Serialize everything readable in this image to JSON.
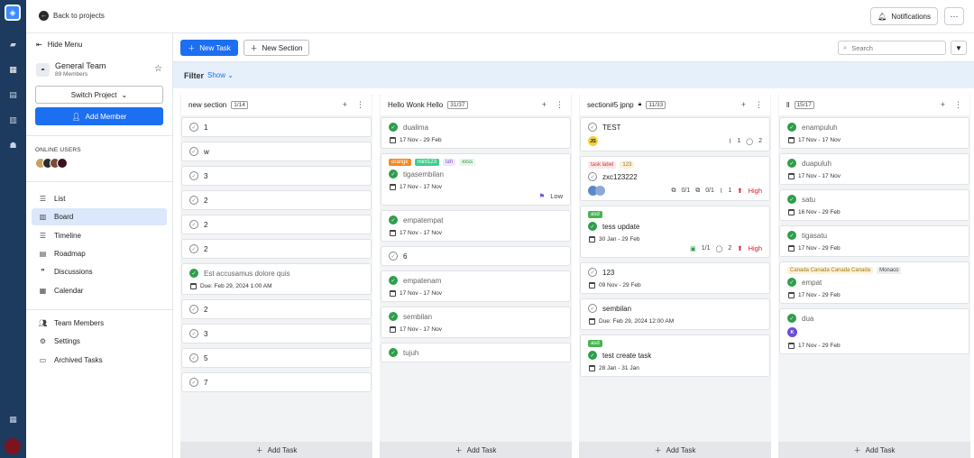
{
  "topbar": {
    "back_label": "Back to projects",
    "notifications_label": "Notifications"
  },
  "sidebar": {
    "hide_menu": "Hide Menu",
    "team_name": "General Team",
    "team_members": "89 Members",
    "switch_project": "Switch Project",
    "add_member": "Add Member",
    "online_users": "ONLINE USERS",
    "online_avatar_colors": [
      "#c8a060",
      "#2b2b2b",
      "#7a4a3a",
      "#3a1020"
    ],
    "views": [
      {
        "label": "List",
        "icon": "list-icon"
      },
      {
        "label": "Board",
        "icon": "board-icon",
        "active": true
      },
      {
        "label": "Timeline",
        "icon": "timeline-icon"
      },
      {
        "label": "Roadmap",
        "icon": "roadmap-icon"
      },
      {
        "label": "Discussions",
        "icon": "discussions-icon"
      },
      {
        "label": "Calendar",
        "icon": "calendar-icon"
      }
    ],
    "settings": [
      {
        "label": "Team Members",
        "icon": "team-members-icon"
      },
      {
        "label": "Settings",
        "icon": "gear-icon"
      },
      {
        "label": "Archived Tasks",
        "icon": "archive-icon"
      }
    ]
  },
  "toolbar": {
    "new_task": "New Task",
    "new_section": "New Section",
    "search_placeholder": "Search"
  },
  "filter": {
    "label": "Filter",
    "show": "Show"
  },
  "add_task_label": "Add Task",
  "columns": [
    {
      "title": "new section",
      "count": "1/14",
      "locked": false,
      "cards": [
        {
          "title": "1"
        },
        {
          "title": "w"
        },
        {
          "title": "3"
        },
        {
          "title": "2"
        },
        {
          "title": "2"
        },
        {
          "title": "2"
        },
        {
          "title": "Est accusamus dolore quis",
          "done": true,
          "muted": true,
          "due": "Due: Feb 29, 2024 1:00 AM"
        },
        {
          "title": "2"
        },
        {
          "title": "3"
        },
        {
          "title": "5"
        },
        {
          "title": "7"
        }
      ]
    },
    {
      "title": "Hello Wonk Hello",
      "count": "31/37",
      "locked": false,
      "cards": [
        {
          "title": "dualima",
          "done": true,
          "muted": true,
          "date": "17 Nov - 29 Feb"
        },
        {
          "title": "tigasembilan",
          "done": true,
          "muted": true,
          "date": "17 Nov - 17 Nov",
          "tags": [
            {
              "text": "orange",
              "bg": "#f08a24",
              "fg": "#fff"
            },
            {
              "text": "mint123",
              "bg": "#3ecf8e",
              "fg": "#fff"
            },
            {
              "text": "lah",
              "bg": "#efe8fb",
              "fg": "#7a5cc4"
            },
            {
              "text": "xxss",
              "bg": "#e8f7ea",
              "fg": "#3a8a4a"
            }
          ],
          "priority": "Low",
          "priority_type": "low"
        },
        {
          "title": "empatempat",
          "done": true,
          "muted": true,
          "date": "17 Nov - 17 Nov"
        },
        {
          "title": "6"
        },
        {
          "title": "empatenam",
          "done": true,
          "muted": true,
          "date": "17 Nov - 17 Nov"
        },
        {
          "title": "sembilan",
          "done": true,
          "muted": true,
          "date": "17 Nov - 17 Nov"
        },
        {
          "title": "tujuh",
          "done": true,
          "muted": true
        }
      ]
    },
    {
      "title": "section#5 jpnp",
      "count": "11/33",
      "locked": true,
      "cards": [
        {
          "title": "TEST",
          "avatar": "JS",
          "avatar_bg": "#f4d13d",
          "attachments": "1",
          "comments": "2"
        },
        {
          "title": "zxc123222",
          "tags": [
            {
              "text": "task label",
              "bg": "#fde7e7",
              "fg": "#b44"
            },
            {
              "text": "123",
              "bg": "#fdf1d8",
              "fg": "#a27a1a"
            }
          ],
          "avatar_group": true,
          "subtasks": "0/1",
          "checklist": "0/1",
          "attachments": "1",
          "priority": "High",
          "priority_type": "high"
        },
        {
          "title": "tess update",
          "done": true,
          "date": "30 Jan - 29 Feb",
          "tags": [
            {
              "text": "asd",
              "bg": "#46b450",
              "fg": "#fff"
            }
          ],
          "subtasks_done": "1/1",
          "comments": "2",
          "priority": "High",
          "priority_type": "high"
        },
        {
          "title": "123",
          "date": "09 Nov - 29 Feb"
        },
        {
          "title": "sembilan",
          "due": "Due: Feb 29, 2024 12:00 AM"
        },
        {
          "title": "test create task",
          "done": true,
          "date": "28 Jan - 31 Jan",
          "tags": [
            {
              "text": "asd",
              "bg": "#46b450",
              "fg": "#fff"
            }
          ]
        }
      ]
    },
    {
      "title": "ll",
      "count": "15/17",
      "locked": false,
      "cards": [
        {
          "title": "enampuluh",
          "done": true,
          "muted": true,
          "date": "17 Nov - 17 Nov"
        },
        {
          "title": "duapuluh",
          "done": true,
          "muted": true,
          "date": "17 Nov - 17 Nov"
        },
        {
          "title": "satu",
          "done": true,
          "muted": true,
          "date": "16 Nov - 29 Feb"
        },
        {
          "title": "tigasatu",
          "done": true,
          "muted": true,
          "date": "17 Nov - 29 Feb"
        },
        {
          "title": "empat",
          "done": true,
          "muted": true,
          "date": "17 Nov - 29 Feb",
          "tags": [
            {
              "text": "Canada Canada Canada Canada",
              "bg": "#fdf1d8",
              "fg": "#a27a1a"
            },
            {
              "text": "Monaco",
              "bg": "#eceef1",
              "fg": "#444"
            }
          ]
        },
        {
          "title": "dua",
          "done": true,
          "muted": true,
          "date": "17 Nov - 29 Feb",
          "avatar": "K",
          "avatar_bg": "#6a4ed8",
          "avatar_fg": "#fff"
        }
      ]
    }
  ]
}
